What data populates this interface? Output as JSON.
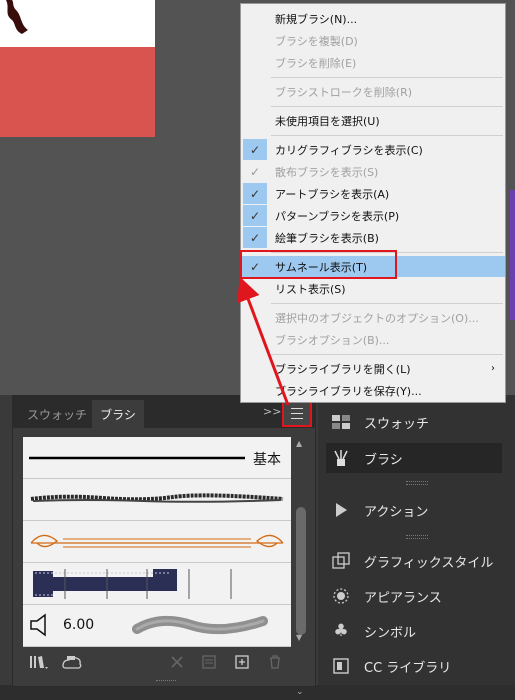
{
  "menu": {
    "items": [
      {
        "label": "新規ブラシ(N)...",
        "enabled": true
      },
      {
        "label": "ブラシを複製(D)",
        "enabled": false
      },
      {
        "label": "ブラシを削除(E)",
        "enabled": false
      },
      {
        "label": "ブラシストロークを削除(R)",
        "enabled": false
      },
      {
        "label": "未使用項目を選択(U)",
        "enabled": true
      },
      {
        "label": "カリグラフィブラシを表示(C)",
        "enabled": true,
        "checked": true
      },
      {
        "label": "散布ブラシを表示(S)",
        "enabled": false,
        "checked": true
      },
      {
        "label": "アートブラシを表示(A)",
        "enabled": true,
        "checked": true
      },
      {
        "label": "パターンブラシを表示(P)",
        "enabled": true,
        "checked": true
      },
      {
        "label": "絵筆ブラシを表示(B)",
        "enabled": true,
        "checked": true
      },
      {
        "label": "サムネール表示(T)",
        "enabled": true,
        "checked": true,
        "highlighted": true
      },
      {
        "label": "リスト表示(S)",
        "enabled": true
      },
      {
        "label": "選択中のオブジェクトのオプション(O)...",
        "enabled": false
      },
      {
        "label": "ブラシオプション(B)...",
        "enabled": false
      },
      {
        "label": "ブラシライブラリを開く(L)",
        "enabled": true,
        "submenu": true
      },
      {
        "label": "ブラシライブラリを保存(Y)...",
        "enabled": true
      }
    ]
  },
  "brush_panel": {
    "tabs": [
      "スウォッチ",
      "ブラシ"
    ],
    "active_tab": "ブラシ",
    "collapse": ">>",
    "basic_label": "基本",
    "bristle_size": "6.00"
  },
  "dock": {
    "items": [
      {
        "label": "スウォッチ",
        "icon": "swatches-icon"
      },
      {
        "label": "ブラシ",
        "icon": "brush-icon",
        "active": true
      },
      {
        "label": "アクション",
        "icon": "play-icon"
      },
      {
        "label": "グラフィックスタイル",
        "icon": "graphic-style-icon"
      },
      {
        "label": "アピアランス",
        "icon": "appearance-icon"
      },
      {
        "label": "シンボル",
        "icon": "club-icon"
      },
      {
        "label": "CC ライブラリ",
        "icon": "cc-library-icon"
      }
    ]
  },
  "colors": {
    "highlight": "#9dc9f0",
    "annotation": "#e0161e",
    "artwork": "#d9534f"
  }
}
